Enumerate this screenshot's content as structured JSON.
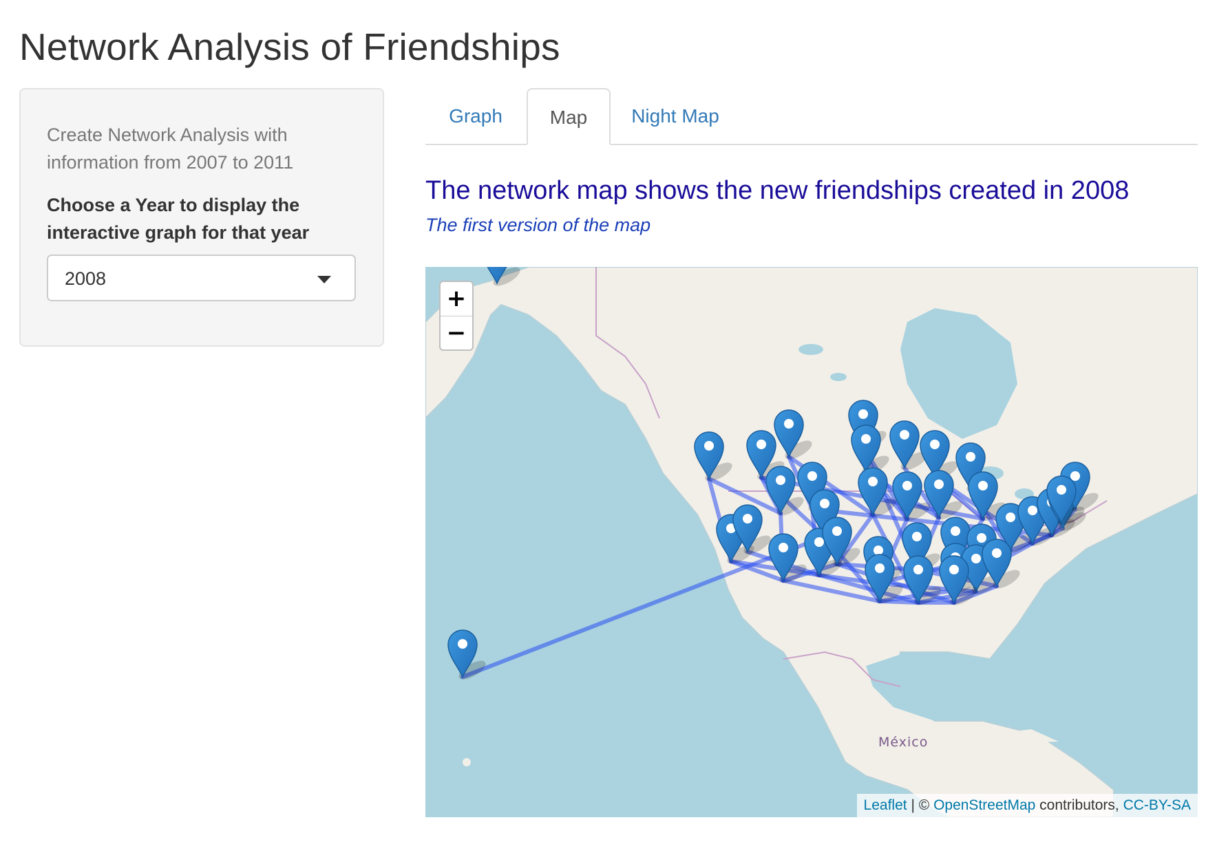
{
  "page": {
    "title": "Network Analysis of Friendships"
  },
  "sidebar": {
    "description": "Create Network Analysis with information from 2007 to 2011",
    "year_label": "Choose a Year to display the interactive graph for that year",
    "year_select": {
      "value": "2008"
    }
  },
  "tabs": [
    {
      "label": "Graph",
      "active": false
    },
    {
      "label": "Map",
      "active": true
    },
    {
      "label": "Night Map",
      "active": false
    }
  ],
  "main": {
    "heading": "The network map shows the new friendships created in 2008",
    "subheading": "The first version of the map"
  },
  "map": {
    "zoom_in": "+",
    "zoom_out": "−",
    "country_label": "México",
    "attribution": {
      "leaflet": "Leaflet",
      "separator": "| ©",
      "osm": "OpenStreetMap",
      "contributors": "contributors,",
      "license": "CC-BY-SA"
    },
    "colors": {
      "water": "#aad3df",
      "land": "#f2efe9",
      "edge": "#2a4ff0",
      "marker": "#2a81cb",
      "marker_dark": "#1b5f9e",
      "border": "#c8a2c8"
    },
    "marker_icon": "map-pin-icon"
  }
}
